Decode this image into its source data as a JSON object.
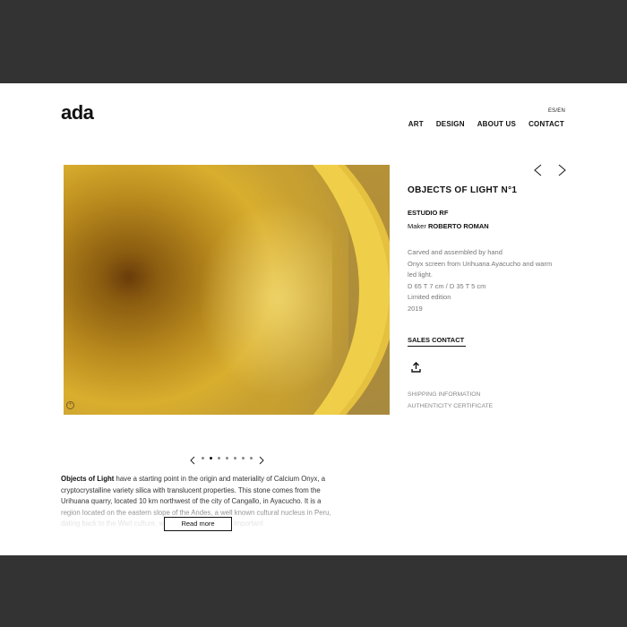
{
  "header": {
    "logo": "ada",
    "lang": "ES/EN",
    "nav": [
      "ART",
      "DESIGN",
      "ABOUT US",
      "CONTACT"
    ]
  },
  "product": {
    "title": "OBJECTS OF LIGHT N°1",
    "studio": "ESTUDIO RF",
    "maker_label": "Maker",
    "maker_name": "ROBERTO ROMAN",
    "description": [
      "Carved and assembled by hand",
      "Onyx screen from  Urihuana Ayacucho and warm",
      "led light.",
      "D 65 T 7 cm / D 35 T 5 cm",
      "Limited edition",
      "2019"
    ],
    "sales_contact": "SALES CONTACT",
    "links": [
      "SHIPPING INFORMATION",
      "AUTHENTICITY CERTIFICATE"
    ]
  },
  "carousel": {
    "count": 7,
    "active": 1
  },
  "about": {
    "bold": "Objects of Light",
    "text": " have a starting point in the origin and materiality of Calcium Onyx, a cryptocrystalline variety silica with translucent properties. This stone comes from the Urihuana quarry, located 10 km northwest of the city of Cangallo, in Ayacucho. It is a region located on the eastern slope of the Andes, a well known  cultural nucleus in Peru, dating back to the Wari culture, which developed a very important",
    "read_more": "Read more"
  },
  "colors": {
    "frame": "#333333",
    "accent_gold": "#d9ae2e"
  }
}
